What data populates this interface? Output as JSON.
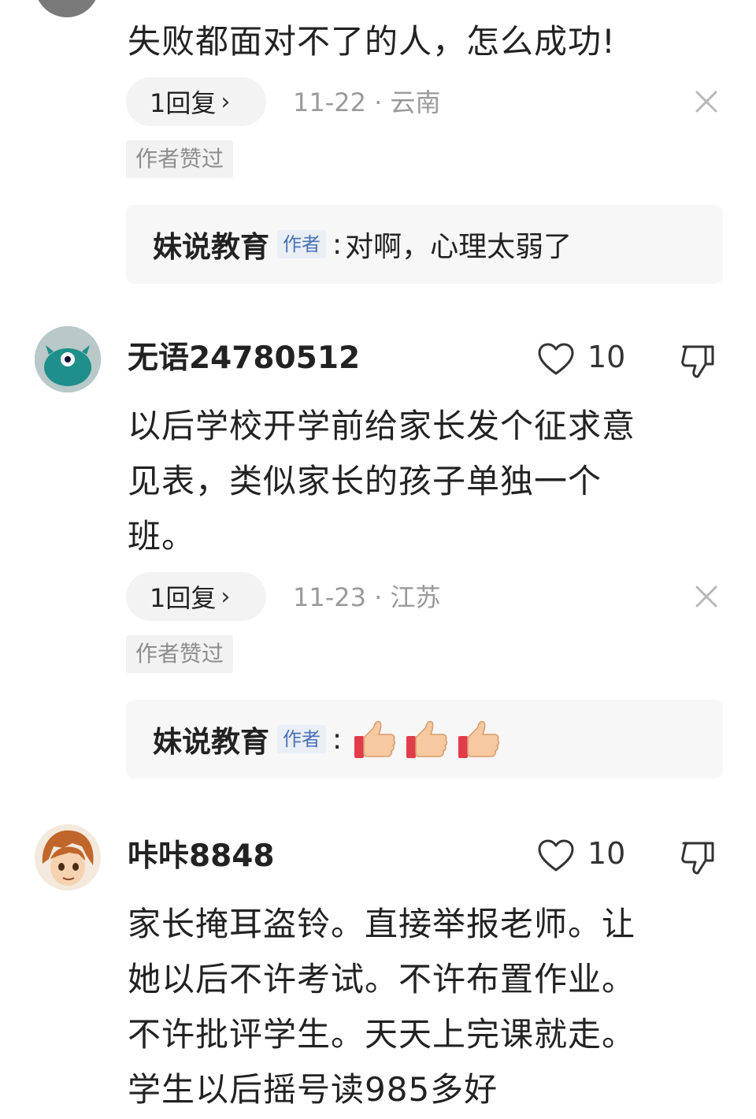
{
  "comments": [
    {
      "text_lines": [
        "失败都面对不了的人，怎么成功!"
      ],
      "reply_count_label": "1回复",
      "chevron": "›",
      "date_location": "11-22 · 云南",
      "author_liked": "作者赞过",
      "author_reply": {
        "name": "妹说教育",
        "tag": "作者",
        "colon": ":",
        "text": "对啊，心理太弱了"
      }
    },
    {
      "username": "无语24780512",
      "likes": "10",
      "text_lines": [
        "以后学校开学前给家长发个征求意",
        "见表，类似家长的孩子单独一个",
        "班。"
      ],
      "reply_count_label": "1回复",
      "chevron": "›",
      "date_location": "11-23 · 江苏",
      "author_liked": "作者赞过",
      "author_reply": {
        "name": "妹说教育",
        "tag": "作者",
        "colon": ":",
        "emoji": [
          "thumbs-up-icon",
          "thumbs-up-icon",
          "thumbs-up-icon"
        ]
      }
    },
    {
      "username": "咔咔8848",
      "likes": "10",
      "text_lines": [
        "家长掩耳盗铃。直接举报老师。让",
        "她以后不许考试。不许布置作业。",
        "不许批评学生。天天上完课就走。",
        "学生以后摇号读985多好"
      ]
    }
  ],
  "colors": {
    "text": "#222222",
    "meta": "#9a9a9a",
    "author_tag_bg": "#e9eef7",
    "author_tag_text": "#4a73b4",
    "reply_bg": "#f7f7f7"
  }
}
